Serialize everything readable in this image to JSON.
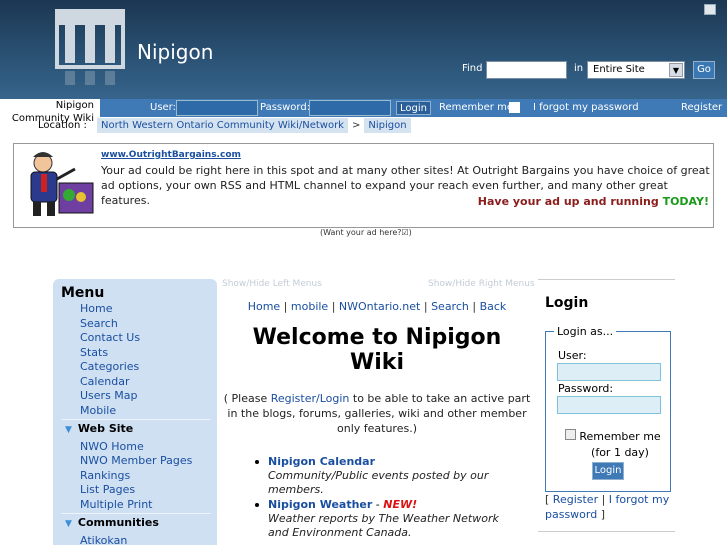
{
  "header": {
    "site_name": "Nipigon",
    "find_label": "Find",
    "in_label": "in",
    "scope": "Entire Site",
    "go": "Go"
  },
  "login_bar": {
    "user_label": "User:",
    "password_label": "Password:",
    "login_button": "Login",
    "remember_me": "Remember me",
    "remember_mark": "✖",
    "forgot": "I forgot my password",
    "register": "Register"
  },
  "community_name": "Nipigon Community Wiki",
  "breadcrumb": {
    "label": "Location :",
    "items": [
      "North Western Ontario Community Wiki/Network",
      "Nipigon"
    ],
    "separator": ">"
  },
  "ad": {
    "link": "www.OutrightBargains.com",
    "text": "Your ad could be right here in this spot and at many other sites! At Outright Bargains you have choice of great ad options, your own RSS and HTML channel to expand your reach even further, and many other great features.",
    "cta": "Have your ad up and running",
    "cta_today": "TODAY!",
    "want": "(Want your ad here?☑)"
  },
  "toggles": {
    "left": "Show/Hide Left Menus",
    "right": "Show/Hide Right Menus"
  },
  "menu": {
    "title": "Menu",
    "items": [
      "Home",
      "Search",
      "Contact Us",
      "Stats",
      "Categories",
      "Calendar",
      "Users Map",
      "Mobile"
    ],
    "sections": [
      {
        "title": "Web Site",
        "items": [
          "NWO Home",
          "NWO Member Pages",
          "Rankings",
          "List Pages",
          "Multiple Print"
        ]
      },
      {
        "title": "Communities",
        "items": [
          "Atikokan"
        ]
      }
    ]
  },
  "main": {
    "links": [
      "Home",
      "mobile",
      "NWOntario.net",
      "Search",
      "Back"
    ],
    "link_sep": " | ",
    "heading": "Welcome to Nipigon Wiki",
    "note_pre": "( Please ",
    "note_link": "Register/Login",
    "note_post": " to be able to take an active part in the blogs, forums, galleries, wiki and other member only features.)",
    "features": [
      {
        "title": "Nipigon Calendar",
        "new": "",
        "desc": "Community/Public events posted by our members."
      },
      {
        "title": "Nipigon Weather",
        "new": "NEW!",
        "desc": "Weather reports by The Weather Network and Environment Canada."
      }
    ]
  },
  "login_box": {
    "title": "Login",
    "legend": "Login as...",
    "user_label": "User:",
    "password_label": "Password:",
    "remember": "Remember me (for 1 day)",
    "button": "Login",
    "register": "Register",
    "forgot": "I forgot my password"
  }
}
